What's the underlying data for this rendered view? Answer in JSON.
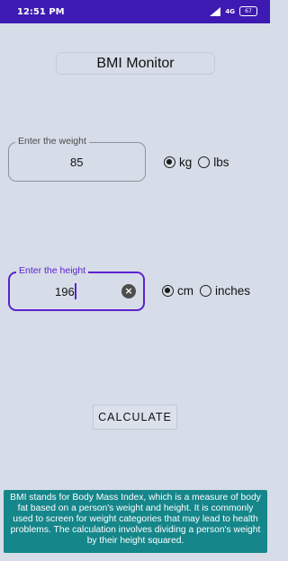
{
  "status_bar": {
    "time": "12:51 PM",
    "network": "4G",
    "battery": "67",
    "bar_color": "#3d1bb2"
  },
  "app": {
    "title": "BMI Monitor"
  },
  "weight": {
    "label": "Enter the weight",
    "value": "85",
    "units": [
      {
        "label": "kg",
        "selected": true
      },
      {
        "label": "lbs",
        "selected": false
      }
    ]
  },
  "height": {
    "label": "Enter the height",
    "value": "196",
    "focused": true,
    "clear_icon": "close-circle-icon",
    "units": [
      {
        "label": "cm",
        "selected": true
      },
      {
        "label": "inches",
        "selected": false
      }
    ]
  },
  "calculate_button": {
    "label": "CALCULATE"
  },
  "info": {
    "text": "BMI stands for Body Mass Index, which is a measure of body fat based on a person's weight and height. It is commonly used to screen for weight categories that may lead to health problems. The calculation involves dividing a person's weight by their height squared.",
    "background": "#15868a"
  },
  "colors": {
    "accent": "#5b22d0",
    "background": "#d6dde8"
  }
}
